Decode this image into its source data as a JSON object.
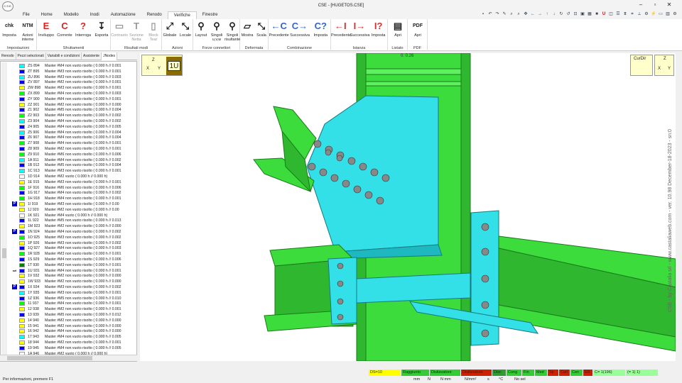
{
  "window": {
    "title": "CSE - [HUGETOS.CSE]",
    "app_logo": "C.S.E."
  },
  "menu": {
    "tabs": [
      "File",
      "Home",
      "Modello",
      "Inodi",
      "Automazione",
      "Renodo",
      "Verifiche",
      "Finestre"
    ],
    "active": "Verifiche"
  },
  "ribbon": {
    "groups": [
      {
        "label": "Impostazioni",
        "buttons": [
          {
            "icon": "chk",
            "label": "Imposta"
          },
          {
            "icon": "NTM",
            "label": "Azioni interne"
          }
        ]
      },
      {
        "label": "Sfruttamenti",
        "buttons": [
          {
            "icon": "E",
            "label": "Inviluppo"
          },
          {
            "icon": "C",
            "label": "Corrente"
          },
          {
            "icon": "?",
            "label": "Interroga"
          },
          {
            "icon": "↧",
            "label": "Esporta"
          }
        ]
      },
      {
        "label": "Risultati modi",
        "buttons": [
          {
            "icon": "▭",
            "label": "Contrasto"
          },
          {
            "icon": "T",
            "label": "Sezione Netta"
          },
          {
            "icon": "▯",
            "label": "Block Tear"
          }
        ]
      },
      {
        "label": "Azioni",
        "buttons": [
          {
            "icon": "⤢",
            "label": "Globale"
          },
          {
            "icon": "⤡",
            "label": "Locale"
          }
        ]
      },
      {
        "label": "Forze connettori",
        "buttons": [
          {
            "icon": "⚲",
            "label": "Layout"
          },
          {
            "icon": "⚲",
            "label": "Singoli u,v,w"
          },
          {
            "icon": "⚲",
            "label": "Singoli risultante"
          }
        ]
      },
      {
        "label": "Deformata",
        "buttons": [
          {
            "icon": "▱",
            "label": "Mostra"
          },
          {
            "icon": "⤡",
            "label": "Scala"
          }
        ]
      },
      {
        "label": "Combinazione",
        "buttons": [
          {
            "icon": "←C",
            "label": "Precedente"
          },
          {
            "icon": "C→",
            "label": "Successiva"
          },
          {
            "icon": "C?",
            "label": "Imposta"
          }
        ]
      },
      {
        "label": "Istanza",
        "buttons": [
          {
            "icon": "←I",
            "label": "Precedente"
          },
          {
            "icon": "I→",
            "label": "Successiva"
          },
          {
            "icon": "I?",
            "label": "Imposta"
          }
        ]
      },
      {
        "label": "Listato",
        "buttons": [
          {
            "icon": "▤",
            "label": "Apri"
          }
        ]
      },
      {
        "label": "PDF",
        "buttons": [
          {
            "icon": "PDF",
            "label": "Apri"
          }
        ]
      }
    ]
  },
  "sidebar": {
    "tabs": [
      "Renodo",
      "Pezzi selezionati",
      "Variabili e condizioni",
      "Assistente",
      "JNodes"
    ],
    "rows": [
      {
        "id": "ZS 894",
        "text": "Master #M4 non vuoto risolto ( 0.000 h // 0.001",
        "color": "#00ffff"
      },
      {
        "id": "ZT 895",
        "text": "Master #M3 non vuoto risolto ( 0.000 h // 0.001",
        "color": "#0000ff"
      },
      {
        "id": "ZU 896",
        "text": "Master #M3 non vuoto risolto ( 0.000 h // 0.003",
        "color": "#00ffff"
      },
      {
        "id": "ZV 897",
        "text": "Master #M2 non vuoto risolto ( 0.000 h // 0.001",
        "color": "#0000ff"
      },
      {
        "id": "ZW 898",
        "text": "Master #M3 non vuoto risolto ( 0.000 h // 0.001",
        "color": "#ffff00"
      },
      {
        "id": "ZX 899",
        "text": "Master #M4 non vuoto risolto ( 0.000 h // 0.003",
        "color": "#00ff00"
      },
      {
        "id": "ZY 900",
        "text": "Master #M4 non vuoto risolto ( 0.000 h // 0.001",
        "color": "#0000ff"
      },
      {
        "id": "ZZ 901",
        "text": "Master #M2 non vuoto risolto ( 0.000 h // 0.000",
        "color": "#ffff00"
      },
      {
        "id": "Z1 902",
        "text": "Master #M5 non vuoto risolto ( 0.000 h // 0.004",
        "color": "#0000ff"
      },
      {
        "id": "Z2 903",
        "text": "Master #M4 non vuoto risolto ( 0.000 h // 0.002",
        "color": "#00ff00"
      },
      {
        "id": "Z3 904",
        "text": "Master #M4 non vuoto risolto ( 0.000 h // 0.002",
        "color": "#00ffff"
      },
      {
        "id": "Z4 905",
        "text": "Master #M4 non vuoto risolto ( 0.000 h // 0.005",
        "color": "#0000ff"
      },
      {
        "id": "Z5 906",
        "text": "Master #M4 non vuoto risolto ( 0.000 h // 0.004",
        "color": "#00ffff"
      },
      {
        "id": "Z6 907",
        "text": "Master #M4 non vuoto risolto ( 0.000 h // 0.004",
        "color": "#0000ff"
      },
      {
        "id": "Z7 908",
        "text": "Master #M4 non vuoto risolto ( 0.000 h // 0.001",
        "color": "#00ff00"
      },
      {
        "id": "Z8 909",
        "text": "Master #M2 non vuoto risolto ( 0.000 h // 0.001",
        "color": "#0000ff"
      },
      {
        "id": "Z9 910",
        "text": "Master #M6 non vuoto risolto ( 0.000 h // 0.006",
        "color": "#00ff00"
      },
      {
        "id": "1A 911",
        "text": "Master #M4 non vuoto risolto ( 0.000 h // 0.002",
        "color": "#00ffff"
      },
      {
        "id": "1B 912",
        "text": "Master #M5 non vuoto risolto ( 0.000 h // 0.004",
        "color": "#0000ff"
      },
      {
        "id": "1C 913",
        "text": "Master #M3 non vuoto risolto ( 0.000 h // 0.001",
        "color": "#00ffff"
      },
      {
        "id": "1D 914",
        "text": "Master #M2 vuoto ( 0.000 h // 0.000 h)",
        "color": "#ffffff"
      },
      {
        "id": "1E 915",
        "text": "Master #M3 non vuoto risolto ( 0.000 h // 0.001",
        "color": "#ffff00"
      },
      {
        "id": "1F 916",
        "text": "Master #M6 non vuoto risolto ( 0.000 h // 0.006",
        "color": "#00ff00"
      },
      {
        "id": "1G 917",
        "text": "Master #M4 non vuoto risolto ( 0.000 h // 0.002",
        "color": "#0000ff"
      },
      {
        "id": "1H 918",
        "text": "Master #M4 non vuoto risolto ( 0.000 h // 0.001",
        "color": "#00ff00"
      },
      {
        "id": "1I 919",
        "text": "Master #M3 non vuoto risolto ( 0.000 h // 0.00",
        "color": "#ffff00",
        "badge": "P"
      },
      {
        "id": "1J 920",
        "text": "Master #M2 non vuoto risolto ( 0.000 h // 0.00",
        "color": "#ffff00"
      },
      {
        "id": "1K 921",
        "text": "Master #M4 vuoto ( 0.000 h // 0.000 h)",
        "color": "#ffffff"
      },
      {
        "id": "1L 922",
        "text": "Master #M5 non vuoto risolto ( 0.000 h // 0.013",
        "color": "#0000ff"
      },
      {
        "id": "1M 923",
        "text": "Master #M2 non vuoto risolto ( 0.000 h // 0.000",
        "color": "#ffff00"
      },
      {
        "id": "1N 924",
        "text": "Master #M4 non vuoto risolto ( 0.000 h // 0.002",
        "color": "#0000ff",
        "badge": "P"
      },
      {
        "id": "1O 925",
        "text": "Master #M3 non vuoto risolto ( 0.000 h // 0.002",
        "color": "#00ff00"
      },
      {
        "id": "1P 926",
        "text": "Master #M3 non vuoto risolto ( 0.000 h // 0.002",
        "color": "#ffff00"
      },
      {
        "id": "1Q 927",
        "text": "Master #M4 non vuoto risolto ( 0.000 h // 0.003",
        "color": "#0000ff"
      },
      {
        "id": "1R 928",
        "text": "Master #M3 non vuoto risolto ( 0.000 h // 0.001",
        "color": "#00ff00"
      },
      {
        "id": "1S 929",
        "text": "Master #M4 non vuoto risolto ( 0.000 h // 0.006",
        "color": "#0000ff"
      },
      {
        "id": "1T 930",
        "text": "Master #M3 non vuoto risolto ( 0.000 h // 0.001",
        "color": "#008000"
      },
      {
        "id": "1U 931",
        "text": "Master #M4 non vuoto risolto ( 0.000 h // 0.001",
        "color": "#0000ff",
        "badge": "sel"
      },
      {
        "id": "1V 932",
        "text": "Master #M2 non vuoto risolto ( 0.000 h // 0.000",
        "color": "#ffff00"
      },
      {
        "id": "1W 933",
        "text": "Master #M2 non vuoto risolto ( 0.000 h // 0.000",
        "color": "#ffff00"
      },
      {
        "id": "1X 934",
        "text": "Master #M3 non vuoto risolto ( 0.000 h // 0.002",
        "color": "#0000ff",
        "badge": "P"
      },
      {
        "id": "1Y 935",
        "text": "Master #M3 non vuoto risolto ( 0.000 h // 0.001",
        "color": "#00ffff"
      },
      {
        "id": "1Z 936",
        "text": "Master #M5 non vuoto risolto ( 0.000 h // 0.010",
        "color": "#0000ff"
      },
      {
        "id": "11 937",
        "text": "Master #M4 non vuoto risolto ( 0.000 h // 0.001",
        "color": "#00ff00"
      },
      {
        "id": "12 938",
        "text": "Master #M2 non vuoto risolto ( 0.000 h // 0.001",
        "color": "#ffff00"
      },
      {
        "id": "13 939",
        "text": "Master #M5 non vuoto risolto ( 0.000 h // 0.012",
        "color": "#0000ff"
      },
      {
        "id": "14 940",
        "text": "Master #M2 non vuoto risolto ( 0.000 h // 0.000",
        "color": "#ffff00"
      },
      {
        "id": "15 941",
        "text": "Master #M2 non vuoto risolto ( 0.000 h // 0.000",
        "color": "#ffff00"
      },
      {
        "id": "16 942",
        "text": "Master #M4 non vuoto risolto ( 0.000 h // 0.000",
        "color": "#ffff00"
      },
      {
        "id": "17 943",
        "text": "Master #M4 non vuoto risolto ( 0.000 h // 0.005",
        "color": "#00ffff"
      },
      {
        "id": "18 944",
        "text": "Master #M2 non vuoto risolto ( 0.000 h // 0.001",
        "color": "#ffff00"
      },
      {
        "id": "19 945",
        "text": "Master #M4 non vuoto risolto ( 0.000 h // 0.005",
        "color": "#0000ff"
      },
      {
        "id": "1A 946",
        "text": "Master #M2 vuoto ( 0.000 h // 0.000 h)",
        "color": "#ffffff"
      }
    ]
  },
  "viewport": {
    "node_label": "1U",
    "top_text": "0: 0.26",
    "axis_left": {
      "z": "Z",
      "x": "X",
      "y": "Y"
    },
    "cur_dir": "CurDir",
    "axis_right": {
      "z": "Z",
      "x": "X",
      "y": "Y"
    },
    "vertical_caption": "CSE - by Castalia srl - www.castaliaweb.com - ver. 10.98 December-18-2023 - sn:0",
    "colors": {
      "cyan": "#33e0e8",
      "green": "#3cdc3c",
      "darkgreen": "#1a7a1a",
      "bolt": "#777777"
    }
  },
  "status": {
    "hint": "Per informazioni, premere F1",
    "row1": [
      {
        "label": "DS=10",
        "bg": "#ffff00"
      },
      {
        "label": "Raggiunto",
        "bg": "#33cc33"
      },
      {
        "label": "Disilavatore",
        "bg": "#33cc33"
      },
      {
        "label": "Disilavatore",
        "bg": "#cc2200"
      },
      {
        "label": "Disc",
        "bg": "#339933"
      },
      {
        "label": "Cong",
        "bg": "#33cc33"
      },
      {
        "label": "Fin",
        "bg": "#33cc33"
      },
      {
        "label": "Med",
        "bg": "#33cc33"
      },
      {
        "label": "Sp",
        "bg": "#cc2200"
      },
      {
        "label": "Carl",
        "bg": "#cc2200"
      },
      {
        "label": "Cen",
        "bg": "#33cc33"
      },
      {
        "label": "ER",
        "bg": "#cc2200"
      },
      {
        "label": "C= 1(196)",
        "bg": "#99ff99"
      },
      {
        "label": "(= 1) 1)",
        "bg": "#99ff99"
      }
    ],
    "row2": [
      "mm",
      "N",
      "N mm",
      "N/mm²",
      "s",
      "°C",
      "No sel"
    ]
  }
}
